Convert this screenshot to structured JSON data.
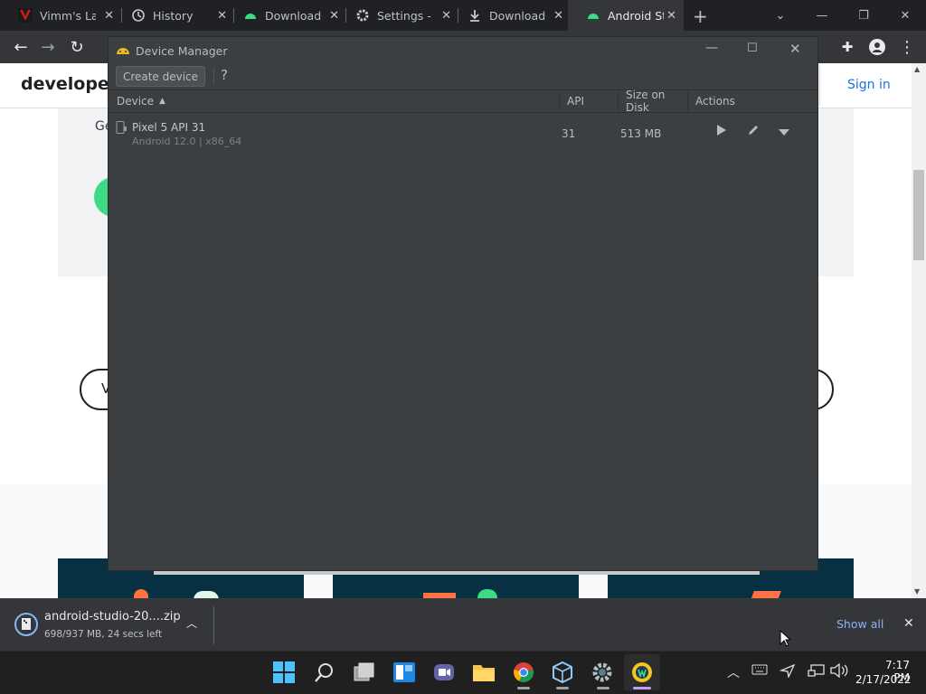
{
  "browser": {
    "tabs": [
      {
        "title": "Vimm's Lair",
        "icon": "vimms-icon"
      },
      {
        "title": "History",
        "icon": "history-icon"
      },
      {
        "title": "Download",
        "icon": "android-icon"
      },
      {
        "title": "Settings - A",
        "icon": "gear-icon"
      },
      {
        "title": "Downloads",
        "icon": "download-icon"
      },
      {
        "title": "Android St",
        "icon": "android-icon"
      }
    ],
    "new_tab": "+",
    "page": {
      "logo": "developers",
      "sign_in": "Sign in",
      "fragment_ge": "Ge",
      "fragment_v": "V"
    }
  },
  "device_manager": {
    "title": "Device Manager",
    "create_button": "Create device",
    "help": "?",
    "columns": [
      "Device",
      "API",
      "Size on Disk",
      "Actions"
    ],
    "devices": [
      {
        "name": "Pixel 5 API 31",
        "detail": "Android 12.0 | x86_64",
        "api": "31",
        "size": "513 MB"
      }
    ]
  },
  "download_bar": {
    "filename": "android-studio-20....zip",
    "progress": "698/937 MB, 24 secs left",
    "show_all": "Show all"
  },
  "taskbar": {
    "time": "7:17 PM",
    "date": "2/17/2022"
  },
  "colors": {
    "accent": "#1a73e8",
    "android_green": "#3ddc84",
    "dark_panel": "#3c3f41"
  }
}
